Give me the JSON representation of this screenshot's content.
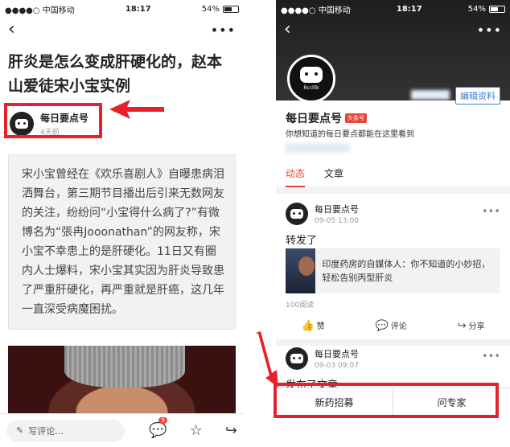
{
  "left": {
    "status": {
      "carrier": "●●●●○ 中国移动",
      "time": "18:17",
      "battery": "54%"
    },
    "title": "肝炎是怎么变成肝硬化的，赵本山爱徒宋小宝实例",
    "author": {
      "name": "每日要点号",
      "time": "4天前"
    },
    "quote": "宋小宝曾经在《欢乐喜剧人》自曝患病泪洒舞台，第三期节目播出后引来无数网友的关注，纷纷问“小宝得什么病了?”有微博名为“張冉Jooonathan”的网友称，宋小宝不幸患上的是肝硬化。11日又有圈内人士爆料，宋小宝其实因为肝炎导致患了严重肝硬化，再严重就是肝癌，这几年一直深受病魔困扰。",
    "bottombar": {
      "comment_placeholder": "写评论...",
      "badge": "9"
    }
  },
  "right": {
    "status": {
      "carrier": "●●●●○ 中国移动",
      "time": "18:17",
      "battery": "54%"
    },
    "avatar_label": "Rcclllk",
    "edit_button": "编辑资料",
    "profile": {
      "name": "每日要点号",
      "tag": "头条号",
      "desc": "你想知道的每日要点都能在这里看到"
    },
    "tabs": [
      "动态",
      "文章"
    ],
    "posts": [
      {
        "name": "每日要点号",
        "time": "09-05 13:00",
        "text": "转发了",
        "share_title": "印度药房的自媒体人：你不知道的小妙招，轻松告别丙型肝炎",
        "reads": "100阅读"
      },
      {
        "name": "每日要点号",
        "time": "09-03 09:07",
        "text": "发布了文章"
      }
    ],
    "actions": {
      "like": "赞",
      "comment": "评论",
      "share": "分享"
    },
    "bottom_buttons": [
      "新药招募",
      "问专家"
    ]
  },
  "colors": {
    "highlight": "#e8202a",
    "accent": "#e8443a",
    "link": "#3f7fd8"
  }
}
